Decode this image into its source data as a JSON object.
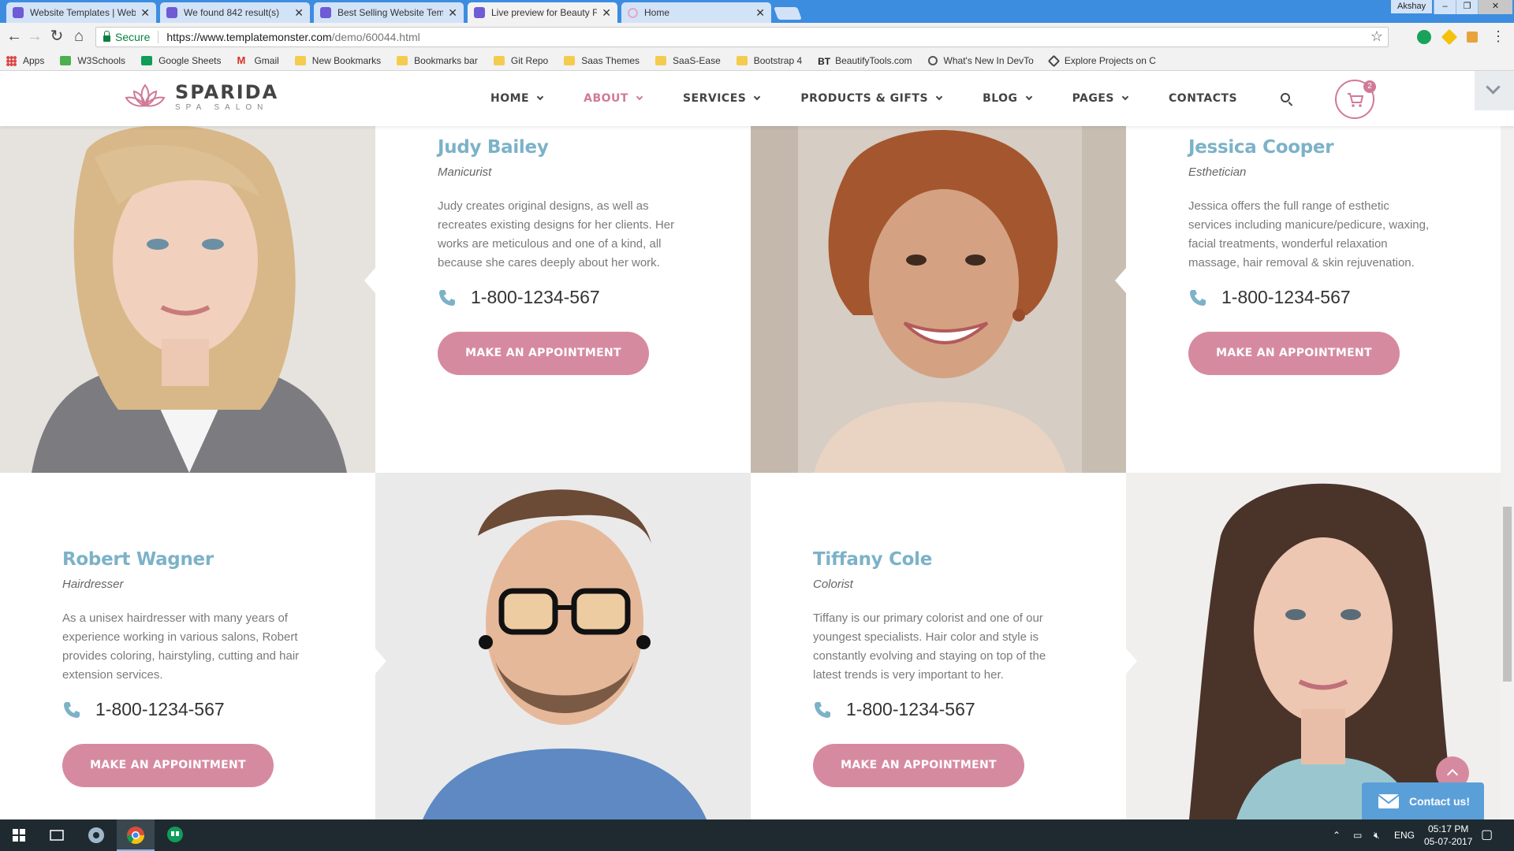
{
  "browser": {
    "tabs": [
      {
        "title": "Website Templates | Web",
        "active": false
      },
      {
        "title": "We found 842 result(s)",
        "active": false
      },
      {
        "title": "Best Selling Website Tem",
        "active": false
      },
      {
        "title": "Live preview for Beauty F",
        "active": true
      },
      {
        "title": "Home",
        "active": false
      }
    ],
    "user": "Akshay",
    "window_controls": {
      "minimize": "–",
      "restore": "❐",
      "close": "✕"
    },
    "security_label": "Secure",
    "url_host": "https://www.templatemonster.com",
    "url_path": "/demo/60044.html",
    "bookmarks": [
      {
        "label": "Apps",
        "icon": "apps-grid-icon"
      },
      {
        "label": "W3Schools",
        "icon": "w3schools-icon"
      },
      {
        "label": "Google Sheets",
        "icon": "sheets-icon"
      },
      {
        "label": "Gmail",
        "icon": "gmail-icon"
      },
      {
        "label": "New Bookmarks",
        "icon": "folder-icon"
      },
      {
        "label": "Bookmarks bar",
        "icon": "folder-icon"
      },
      {
        "label": "Git Repo",
        "icon": "folder-icon"
      },
      {
        "label": "Saas Themes",
        "icon": "folder-icon"
      },
      {
        "label": "SaaS-Ease",
        "icon": "folder-icon"
      },
      {
        "label": "Bootstrap 4",
        "icon": "folder-icon"
      },
      {
        "label": "BeautifyTools.com",
        "icon": "bt-icon"
      },
      {
        "label": "What's New In DevTo",
        "icon": "devtools-icon"
      },
      {
        "label": "Explore Projects on C",
        "icon": "codepen-icon"
      }
    ]
  },
  "site": {
    "brand": "SPARIDA",
    "tagline": "SPA SALON",
    "accent_color": "#d07a96",
    "name_color": "#7cb2c8",
    "menu": [
      {
        "label": "HOME",
        "dropdown": true,
        "active": false
      },
      {
        "label": "ABOUT",
        "dropdown": true,
        "active": true
      },
      {
        "label": "SERVICES",
        "dropdown": true,
        "active": false
      },
      {
        "label": "PRODUCTS & GIFTS",
        "dropdown": true,
        "active": false
      },
      {
        "label": "BLOG",
        "dropdown": true,
        "active": false
      },
      {
        "label": "PAGES",
        "dropdown": true,
        "active": false
      },
      {
        "label": "CONTACTS",
        "dropdown": false,
        "active": false
      }
    ],
    "cart_count": "2"
  },
  "team": [
    {
      "name": "Judy Bailey",
      "role": "Manicurist",
      "bio": "Judy creates original designs, as well as recreates existing designs for her clients. Her works are meticulous and one of a kind, all because she cares deeply about her work.",
      "phone": "1-800-1234-567",
      "cta": "MAKE AN APPOINTMENT"
    },
    {
      "name": "Jessica Cooper",
      "role": "Esthetician",
      "bio": "Jessica offers the full range of esthetic services including manicure/pedicure, waxing, facial treatments, wonderful relaxation massage, hair removal & skin rejuvenation.",
      "phone": "1-800-1234-567",
      "cta": "MAKE AN APPOINTMENT"
    },
    {
      "name": "Robert Wagner",
      "role": "Hairdresser",
      "bio": "As a unisex hairdresser with many years of experience working in various salons, Robert provides coloring, hairstyling, cutting and hair extension services.",
      "phone": "1-800-1234-567",
      "cta": "MAKE AN APPOINTMENT"
    },
    {
      "name": "Tiffany Cole",
      "role": "Colorist",
      "bio": "Tiffany is our primary colorist and one of our youngest specialists. Hair color and style is constantly evolving and staying on top of the latest trends is very important to her.",
      "phone": "1-800-1234-567",
      "cta": "MAKE AN APPOINTMENT"
    }
  ],
  "widgets": {
    "contact_us": "Contact us!"
  },
  "taskbar": {
    "language": "ENG",
    "time": "05:17 PM",
    "date": "05-07-2017"
  }
}
